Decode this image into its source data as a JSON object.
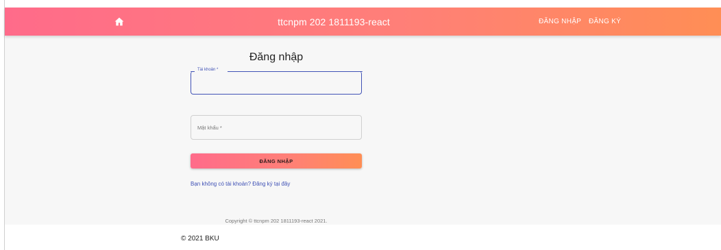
{
  "appbar": {
    "title": "ttcnpm 202 1811193-react",
    "home_icon": "home-icon",
    "nav": {
      "login": "ĐĂNG NHẬP",
      "register": "ĐĂNG KÝ"
    },
    "gradient_start": "#ff6b8a",
    "gradient_end": "#ff8e55"
  },
  "form": {
    "title": "Đăng nhập",
    "username_label": "Tài khoản *",
    "username_value": "",
    "password_label": "Mật khẩu *",
    "submit_label": "ĐĂNG NHẬP",
    "register_prompt": "Bạn không có tài khoản? Đăng ký tại đây",
    "accent": "#3f51b5"
  },
  "copyright": "Copyright © ttcnpm 202 1811193-react 2021.",
  "footer": {
    "text": "© 2021 BKU"
  }
}
